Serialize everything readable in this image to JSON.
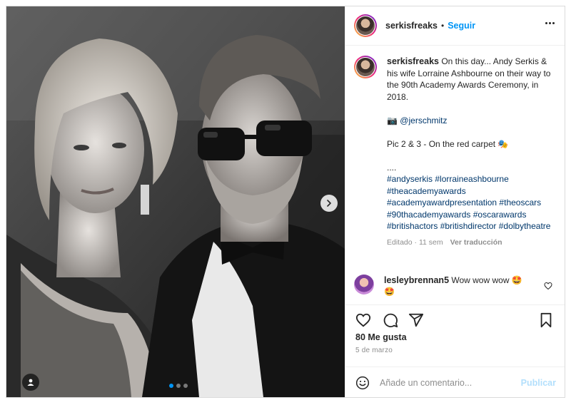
{
  "post": {
    "username": "serkisfreaks",
    "separator": "•",
    "follow_label": "Seguir",
    "caption": {
      "text1": "On this day... Andy Serkis & his wife Lorraine Ashbourne on their way to the 90th Academy Awards Ceremony, in 2018.",
      "camera_icon": "📷",
      "photographer": "@jerschmitz",
      "pics_line": "Pic 2 & 3 - On the red carpet 🎭",
      "ellipsis": "....",
      "hashtags": "#andyserkis #lorraineashbourne #theacademyawards #academyawardpresentation #theoscars #90thacademyawards #oscarawards #britishactors #britishdirector #dolbytheatre",
      "edited": "Editado · 11 sem",
      "translate_label": "Ver traducción"
    },
    "comment": {
      "username": "lesleybrennan5",
      "text": "Wow wow wow 🤩 🤩"
    },
    "likes": "80 Me gusta",
    "date": "5 de marzo",
    "comment_placeholder": "Añade un comentario...",
    "publish_label": "Publicar",
    "carousel": {
      "count": 3,
      "active": 1
    }
  },
  "colors": {
    "accent": "#0095f6",
    "link": "#00376b",
    "muted": "#8e8e8e",
    "publish_disabled": "#b2dffc"
  },
  "icons": [
    "chevron-right-icon",
    "user-tag-icon",
    "more-options-icon",
    "heart-icon",
    "comment-icon",
    "share-icon",
    "bookmark-icon",
    "emoji-icon",
    "camera-icon"
  ]
}
